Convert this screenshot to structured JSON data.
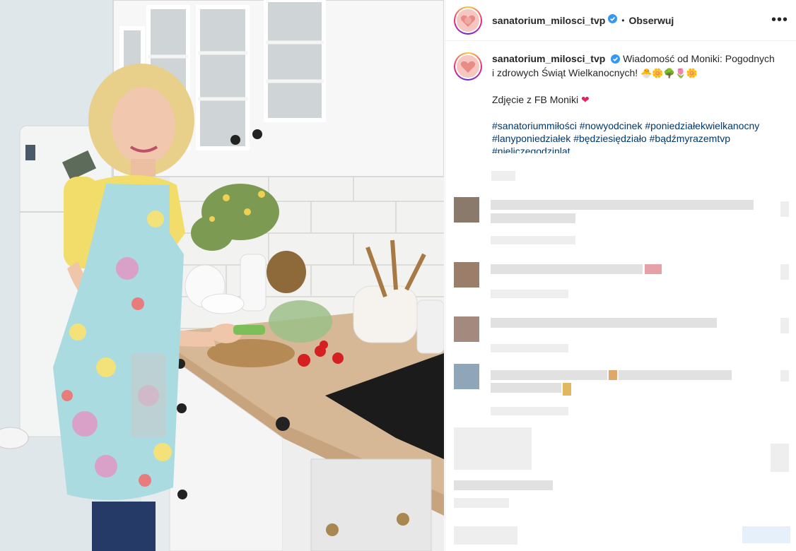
{
  "post": {
    "username": "sanatorium_milosci_tvp",
    "follow_label": "Obserwuj",
    "separator": "•",
    "more_label": "•••",
    "caption": {
      "line1": "Wiadomość od Moniki: Pogodnych i",
      "line2": "zdrowych Świąt Wielkanocnych!",
      "emojis": "🐣🌼🌳🌷🌼",
      "photo_credit": "Zdjęcie z FB Moniki",
      "heart": "❤",
      "hashtags": [
        "#sanatoriummiłości",
        "#nowyodcinek",
        "#poniedziałekwielkanocny",
        "#lanyponiedziałek",
        "#będziesiędziało",
        "#bądźmyrazemtvp",
        "#nieliczegodzinlat"
      ]
    }
  },
  "colors": {
    "text": "#262626",
    "link": "#00376b",
    "verified": "#3897f0",
    "heart": "#e0245e"
  }
}
